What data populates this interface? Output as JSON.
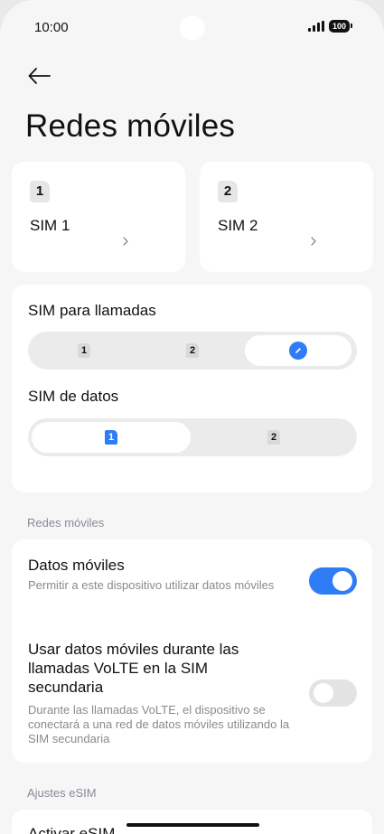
{
  "status_bar": {
    "time": "10:00",
    "battery": "100"
  },
  "header": {
    "title": "Redes móviles"
  },
  "sim_cards": [
    {
      "number": "1",
      "name": "SIM 1"
    },
    {
      "number": "2",
      "name": "SIM 2"
    }
  ],
  "sim_settings": {
    "calls_heading": "SIM para llamadas",
    "calls_options": [
      "1",
      "2",
      "edit"
    ],
    "calls_selected": "edit",
    "data_heading": "SIM de datos",
    "data_options": [
      "1",
      "2"
    ],
    "data_selected": "1"
  },
  "mobile_networks": {
    "group_label": "Redes móviles",
    "mobile_data": {
      "title": "Datos móviles",
      "description": "Permitir a este dispositivo utilizar datos móviles",
      "enabled": true
    },
    "volte_data": {
      "title": "Usar datos móviles durante las llamadas VoLTE en la SIM secundaria",
      "description": "Durante las llamadas VoLTE, el dispositivo se conectará a una red de datos móviles utilizando la SIM secundaria",
      "enabled": false
    }
  },
  "esim": {
    "group_label": "Ajustes eSIM",
    "activate_label": "Activar eSIM"
  },
  "colors": {
    "accent": "#2f7cf6",
    "background": "#f6f6f6",
    "card": "#ffffff",
    "muted_text": "#8a8a8a"
  }
}
